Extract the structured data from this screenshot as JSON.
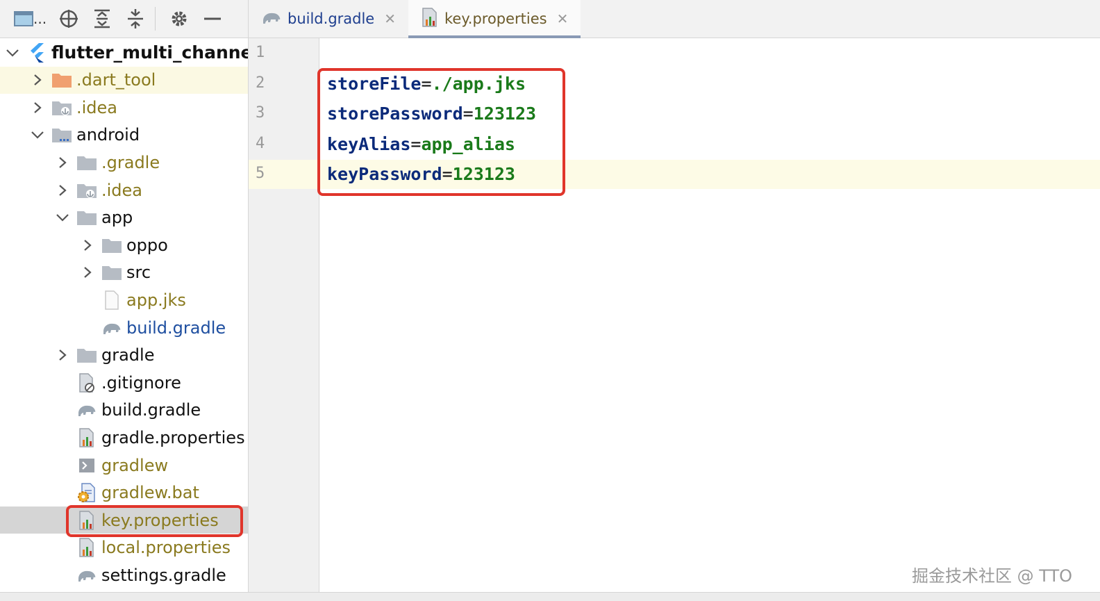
{
  "toolbar": {
    "dots": "...",
    "buttons": [
      "panel-icon",
      "locate-icon",
      "expand-all-icon",
      "collapse-all-icon",
      "gear-icon",
      "minimize-icon"
    ]
  },
  "tabs": [
    {
      "label": "build.gradle",
      "icon": "gradle-elephant-icon",
      "active": false
    },
    {
      "label": "key.properties",
      "icon": "properties-file-icon",
      "active": true
    }
  ],
  "tree": [
    {
      "label": "flutter_multi_channel",
      "depth": 0,
      "chevron": "down",
      "icon": "flutter-icon",
      "style": "bold"
    },
    {
      "label": ".dart_tool",
      "depth": 1,
      "chevron": "right",
      "icon": "folder-orange-icon",
      "style": "dim",
      "highlight": true
    },
    {
      "label": ".idea",
      "depth": 1,
      "chevron": "right",
      "icon": "folder-idea-icon",
      "style": "dim"
    },
    {
      "label": "android",
      "depth": 1,
      "chevron": "down",
      "icon": "folder-module-icon",
      "style": "normal"
    },
    {
      "label": ".gradle",
      "depth": 2,
      "chevron": "right",
      "icon": "folder-icon",
      "style": "dim"
    },
    {
      "label": ".idea",
      "depth": 2,
      "chevron": "right",
      "icon": "folder-idea-icon",
      "style": "dim"
    },
    {
      "label": "app",
      "depth": 2,
      "chevron": "down",
      "icon": "folder-icon",
      "style": "normal"
    },
    {
      "label": "oppo",
      "depth": 3,
      "chevron": "right",
      "icon": "folder-icon",
      "style": "normal"
    },
    {
      "label": "src",
      "depth": 3,
      "chevron": "right",
      "icon": "folder-icon",
      "style": "normal"
    },
    {
      "label": "app.jks",
      "depth": 3,
      "chevron": "",
      "icon": "file-icon",
      "style": "dim"
    },
    {
      "label": "build.gradle",
      "depth": 3,
      "chevron": "",
      "icon": "gradle-elephant-icon",
      "style": "blue"
    },
    {
      "label": "gradle",
      "depth": 2,
      "chevron": "right",
      "icon": "folder-icon",
      "style": "normal"
    },
    {
      "label": ".gitignore",
      "depth": 2,
      "chevron": "",
      "icon": "gitignore-icon",
      "style": "normal"
    },
    {
      "label": "build.gradle",
      "depth": 2,
      "chevron": "",
      "icon": "gradle-elephant-icon",
      "style": "normal"
    },
    {
      "label": "gradle.properties",
      "depth": 2,
      "chevron": "",
      "icon": "properties-file-icon",
      "style": "normal"
    },
    {
      "label": "gradlew",
      "depth": 2,
      "chevron": "",
      "icon": "terminal-file-icon",
      "style": "dim"
    },
    {
      "label": "gradlew.bat",
      "depth": 2,
      "chevron": "",
      "icon": "bat-file-icon",
      "style": "dim"
    },
    {
      "label": "key.properties",
      "depth": 2,
      "chevron": "",
      "icon": "properties-file-icon",
      "style": "dim",
      "selected": true
    },
    {
      "label": "local.properties",
      "depth": 2,
      "chevron": "",
      "icon": "properties-file-icon",
      "style": "dim"
    },
    {
      "label": "settings.gradle",
      "depth": 2,
      "chevron": "",
      "icon": "gradle-elephant-icon",
      "style": "normal"
    }
  ],
  "editor": {
    "line_numbers": [
      "1",
      "2",
      "3",
      "4",
      "5"
    ],
    "current_line": 5,
    "lines": [
      {
        "key": "",
        "eq": "",
        "value": ""
      },
      {
        "key": "storeFile",
        "eq": "=",
        "value": "./app.jks"
      },
      {
        "key": "storePassword",
        "eq": "=",
        "value": "123123"
      },
      {
        "key": "keyAlias",
        "eq": "=",
        "value": "app_alias"
      },
      {
        "key": "keyPassword",
        "eq": "=",
        "value": "123123"
      }
    ]
  },
  "watermark": "掘金技术社区 @ TTO",
  "colors": {
    "highlight_box": "#e0352b",
    "key_color": "#0b2a7a",
    "value_color": "#1a7a1a"
  }
}
